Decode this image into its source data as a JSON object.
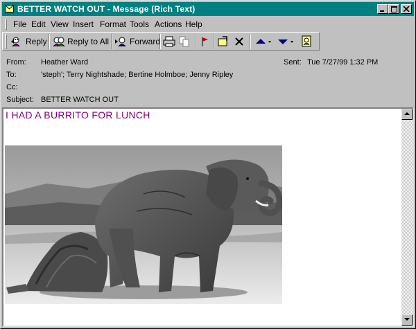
{
  "window": {
    "title": "BETTER WATCH OUT - Message (Rich Text)"
  },
  "menu": {
    "items": [
      "File",
      "Edit",
      "View",
      "Insert",
      "Format",
      "Tools",
      "Actions",
      "Help"
    ]
  },
  "toolbar": {
    "reply_label": "Reply",
    "reply_all_label": "Reply to All",
    "forward_label": "Forward"
  },
  "header": {
    "from_label": "From:",
    "from_value": "Heather Ward",
    "sent_label": "Sent:",
    "sent_value": "Tue 7/27/99 1:32 PM",
    "to_label": "To:",
    "to_value": "'steph'; Terry Nightshade; Bertine Holmboe; Jenny Ripley",
    "cc_label": "Cc:",
    "cc_value": "",
    "subject_label": "Subject:",
    "subject_value": "BETTER WATCH OUT"
  },
  "body": {
    "text": "I HAD A BURRITO FOR LUNCH",
    "text_color": "#800080"
  },
  "colors": {
    "titlebar": "#008080",
    "chrome": "#c0c0c0"
  },
  "icons": [
    "envelope-icon",
    "minimize-icon",
    "maximize-icon",
    "close-icon",
    "reply-icon",
    "reply-all-icon",
    "forward-icon",
    "print-icon",
    "copy-icon",
    "flag-icon",
    "move-to-folder-icon",
    "delete-icon",
    "previous-item-icon",
    "next-item-icon",
    "address-book-icon"
  ]
}
